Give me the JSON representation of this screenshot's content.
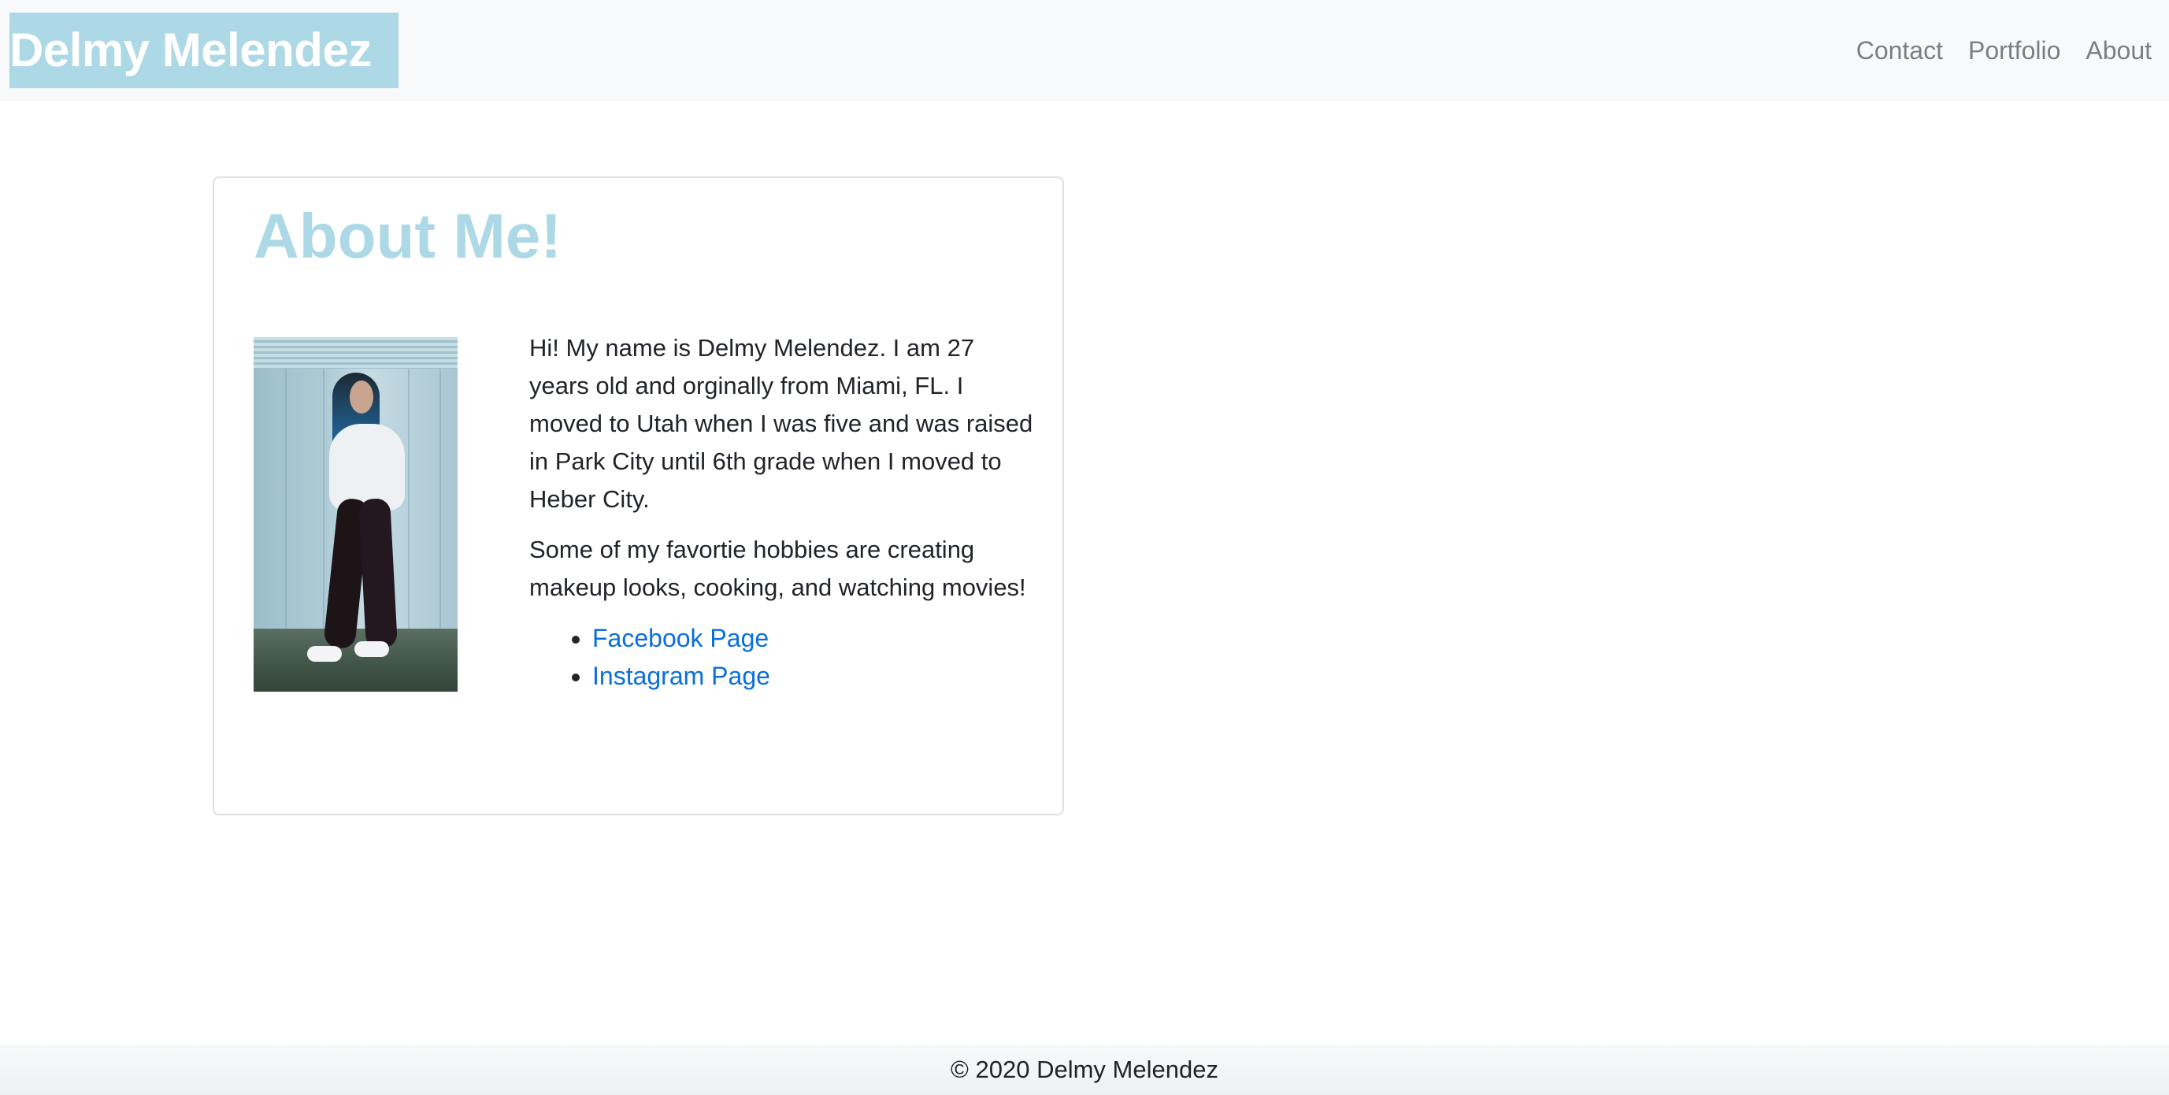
{
  "navbar": {
    "brand": "Delmy Melendez",
    "links": [
      "Contact",
      "Portfolio",
      "About"
    ]
  },
  "card": {
    "title": "About Me!",
    "paragraph1": "Hi! My name is Delmy Melendez. I am 27 years old and orginally from Miami, FL. I moved to Utah when I was five and was raised in Park City until 6th grade when I moved to Heber City.",
    "paragraph2": "Some of my favortie hobbies are creating makeup looks, cooking, and watching movies!",
    "links": [
      "Facebook Page",
      "Instagram Page"
    ]
  },
  "footer": {
    "text": "© 2020 Delmy Melendez"
  },
  "colors": {
    "brand_bg": "#add8e6",
    "title": "#add8e6",
    "link": "#0a6edb",
    "navbar_bg": "#f8f9fa"
  }
}
